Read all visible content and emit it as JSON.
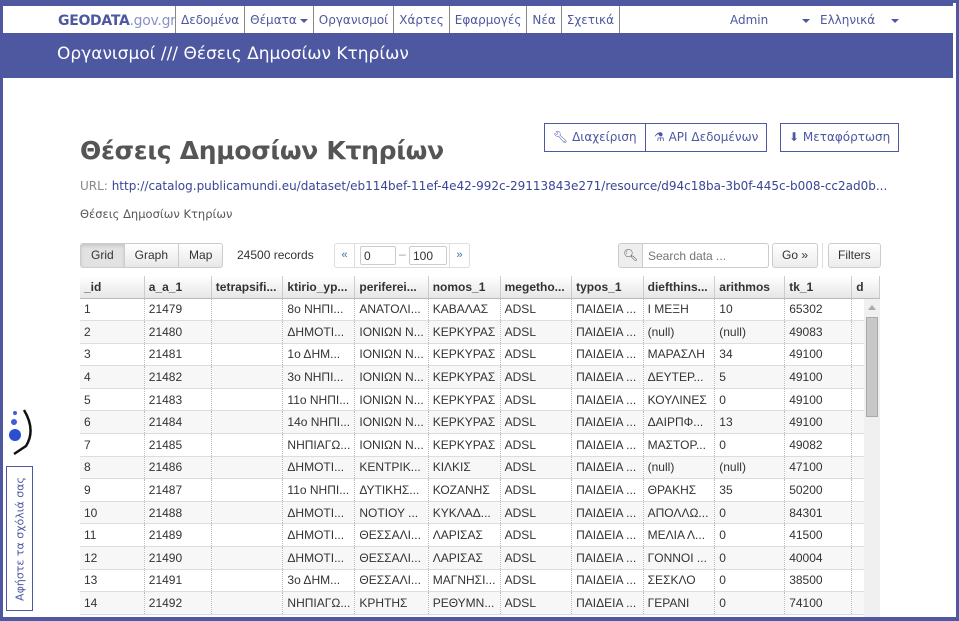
{
  "nav": {
    "brand_main": "GEODATA",
    "brand_suffix": ".gov.gr",
    "links": [
      "Δεδομένα",
      "Θέματα",
      "Οργανισμοί",
      "Χάρτες",
      "Εφαρμογές",
      "Νέα",
      "Σχετικά"
    ],
    "user": "Admin",
    "language": "Ελληνικά"
  },
  "breadcrumb": {
    "parent": "Οργανισμοί",
    "separator": "///",
    "current": "Θέσεις Δημοσίων Κτηρίων"
  },
  "resource": {
    "title": "Θέσεις Δημοσίων Κτηρίων",
    "url_label": "URL:",
    "url": "http://catalog.publicamundi.eu/dataset/eb114bef-11ef-4e42-992c-29113843e271/resource/d94c18ba-3b0f-445c-b008-cc2ad0b...",
    "description": "Θέσεις Δημοσίων Κτηρίων",
    "actions": {
      "manage": "Διαχείριση",
      "api": "API Δεδομένων",
      "download": "Μεταφόρτωση"
    }
  },
  "toolbar": {
    "views": [
      "Grid",
      "Graph",
      "Map"
    ],
    "active_view": "Grid",
    "records": "24500 records",
    "pager_prev": "«",
    "pager_next": "»",
    "pager_from": "0",
    "pager_to": "100",
    "search_placeholder": "Search data ...",
    "go_label": "Go »",
    "filters_label": "Filters"
  },
  "grid": {
    "columns": [
      "_id",
      "a_a_1",
      "tetrapsifi...",
      "ktirio_yp...",
      "periferei...",
      "nomos_1",
      "megetho...",
      "typos_1",
      "diefthins...",
      "arithmos",
      "tk_1",
      "d"
    ],
    "rows": [
      [
        "1",
        "21479",
        "",
        "8ο ΝΗΠΙ...",
        "ΑΝΑΤΟΛΙ...",
        "ΚΑΒΑΛΑΣ",
        "ADSL",
        "ΠΑΙΔΕΙΑ ...",
        "Ι ΜΕΞΗ",
        "10",
        "65302"
      ],
      [
        "2",
        "21480",
        "",
        "ΔΗΜΟΤΙ...",
        "ΙΟΝΙΩΝ Ν...",
        "ΚΕΡΚΥΡΑΣ",
        "ADSL",
        "ΠΑΙΔΕΙΑ ...",
        "(null)",
        "(null)",
        "49083"
      ],
      [
        "3",
        "21481",
        "",
        "1ο ΔΗΜ...",
        "ΙΟΝΙΩΝ Ν...",
        "ΚΕΡΚΥΡΑΣ",
        "ADSL",
        "ΠΑΙΔΕΙΑ ...",
        "ΜΑΡΑΣΛΗ",
        "34",
        "49100"
      ],
      [
        "4",
        "21482",
        "",
        "3ο ΝΗΠΙ...",
        "ΙΟΝΙΩΝ Ν...",
        "ΚΕΡΚΥΡΑΣ",
        "ADSL",
        "ΠΑΙΔΕΙΑ ...",
        "ΔΕΥΤΕΡ...",
        "5",
        "49100"
      ],
      [
        "5",
        "21483",
        "",
        "11ο ΝΗΠΙ...",
        "ΙΟΝΙΩΝ Ν...",
        "ΚΕΡΚΥΡΑΣ",
        "ADSL",
        "ΠΑΙΔΕΙΑ ...",
        "ΚΟΥΛΙΝΕΣ",
        "0",
        "49100"
      ],
      [
        "6",
        "21484",
        "",
        "14ο ΝΗΠΙ...",
        "ΙΟΝΙΩΝ Ν...",
        "ΚΕΡΚΥΡΑΣ",
        "ADSL",
        "ΠΑΙΔΕΙΑ ...",
        "ΔΑΙΡΠΦ...",
        "13",
        "49100"
      ],
      [
        "7",
        "21485",
        "",
        "ΝΗΠΙΑΓΩ...",
        "ΙΟΝΙΩΝ Ν...",
        "ΚΕΡΚΥΡΑΣ",
        "ADSL",
        "ΠΑΙΔΕΙΑ ...",
        "ΜΑΣΤΟΡ...",
        "0",
        "49082"
      ],
      [
        "8",
        "21486",
        "",
        "ΔΗΜΟΤΙ...",
        "ΚΕΝΤΡΙΚ...",
        "ΚΙΛΚΙΣ",
        "ADSL",
        "ΠΑΙΔΕΙΑ ...",
        "(null)",
        "(null)",
        "47100"
      ],
      [
        "9",
        "21487",
        "",
        "11ο ΝΗΠΙ...",
        "ΔΥΤΙΚΗΣ...",
        "ΚΟΖΑΝΗΣ",
        "ADSL",
        "ΠΑΙΔΕΙΑ ...",
        "ΘΡΑΚΗΣ",
        "35",
        "50200"
      ],
      [
        "10",
        "21488",
        "",
        "ΔΗΜΟΤΙ...",
        "ΝΟΤΙΟΥ ...",
        "ΚΥΚΛΑΔ...",
        "ADSL",
        "ΠΑΙΔΕΙΑ ...",
        "ΑΠΟΛΛΩ...",
        "0",
        "84301"
      ],
      [
        "11",
        "21489",
        "",
        "ΔΗΜΟΤΙ...",
        "ΘΕΣΣΑΛΙ...",
        "ΛΑΡΙΣΑΣ",
        "ADSL",
        "ΠΑΙΔΕΙΑ ...",
        "ΜΕΛΙΑ Λ...",
        "0",
        "41500"
      ],
      [
        "12",
        "21490",
        "",
        "ΔΗΜΟΤΙ...",
        "ΘΕΣΣΑΛΙ...",
        "ΛΑΡΙΣΑΣ",
        "ADSL",
        "ΠΑΙΔΕΙΑ ...",
        "ΓΟΝΝΟΙ ...",
        "0",
        "40004"
      ],
      [
        "13",
        "21491",
        "",
        "3ο ΔΗΜ...",
        "ΘΕΣΣΑΛΙ...",
        "ΜΑΓΝΗΣΙ...",
        "ADSL",
        "ΠΑΙΔΕΙΑ ...",
        "ΣΕΣΚΛΟ",
        "0",
        "38500"
      ],
      [
        "14",
        "21492",
        "",
        "ΝΗΠΙΑΓΩ...",
        "ΚΡΗΤΗΣ",
        "ΡΕΘΥΜΝ...",
        "ADSL",
        "ΠΑΙΔΕΙΑ ...",
        "ΓΕΡΑΝΙ",
        "0",
        "74100"
      ]
    ]
  },
  "feedback": {
    "label": "Αφήστε τα σχόλιά σας"
  },
  "colors": {
    "brand": "#4d58a0"
  }
}
